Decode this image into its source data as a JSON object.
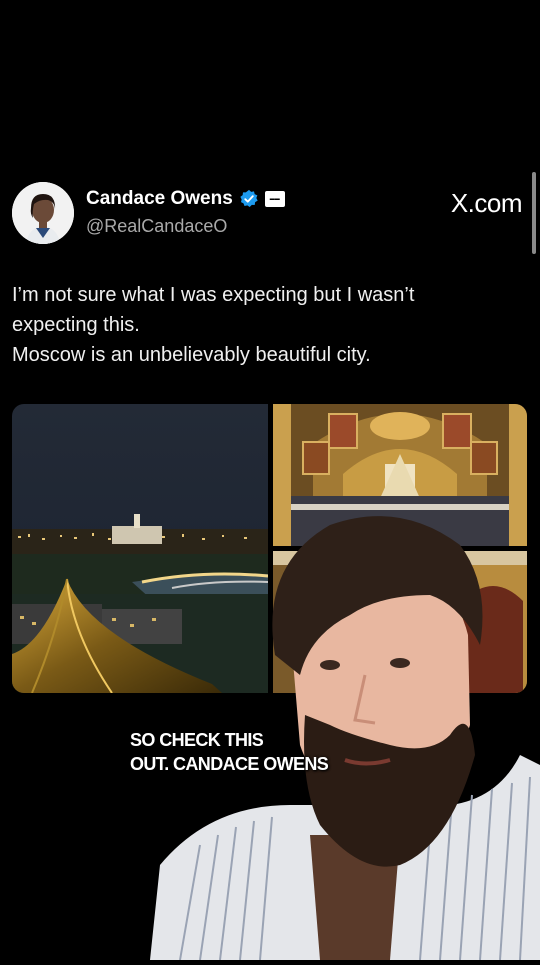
{
  "tweet": {
    "display_name": "Candace Owens",
    "handle": "@RealCandaceO",
    "site_logo": "X.com",
    "text_lines": [
      "I’m not sure what I was expecting but I wasn’t",
      "expecting this.",
      "Moscow is an unbelievably beautiful city."
    ],
    "verified_color": "#1d9bf0"
  },
  "video": {
    "caption_lines": [
      "SO CHECK THIS",
      "OUT. CANDACE OWENS"
    ]
  },
  "icons": [
    "verified-badge-icon",
    "affiliate-badge-icon"
  ]
}
